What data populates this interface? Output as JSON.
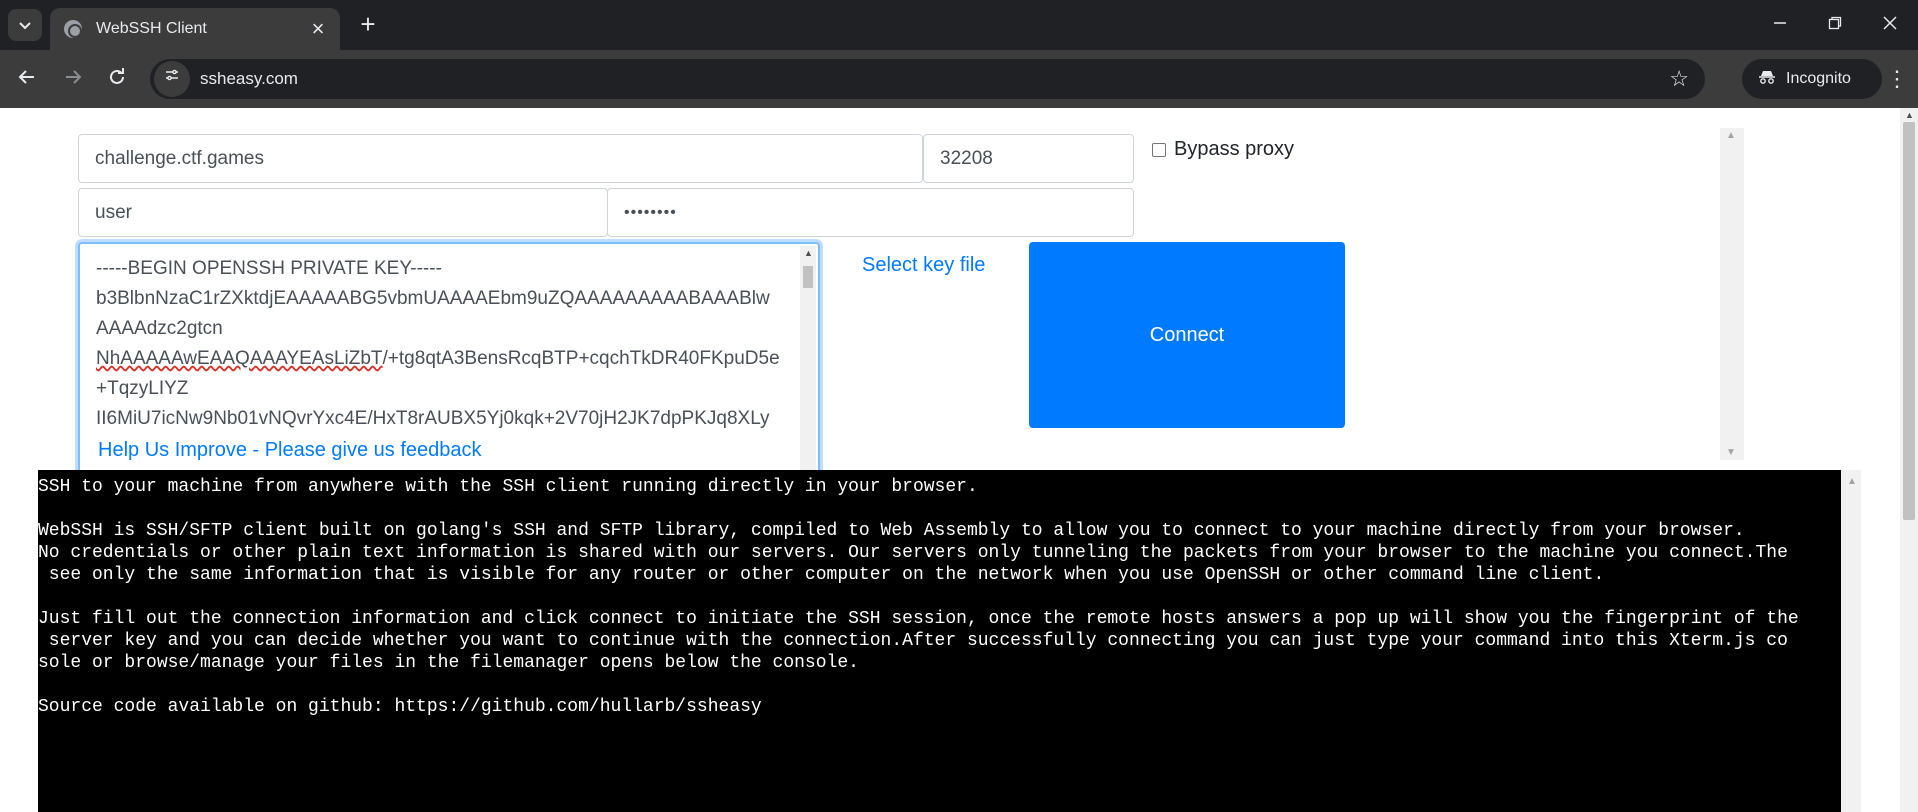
{
  "browser": {
    "tab_title": "WebSSH Client",
    "url": "ssheasy.com",
    "incognito_label": "Incognito",
    "icons": [
      "tab-search-icon",
      "favicon-icon",
      "close-icon",
      "new-tab-icon",
      "minimize-icon",
      "restore-icon",
      "window-close-icon",
      "back-icon",
      "forward-icon",
      "reload-icon",
      "site-info-icon",
      "bookmark-star-icon",
      "incognito-icon",
      "menu-icon"
    ]
  },
  "form": {
    "host": "challenge.ctf.games",
    "port": "32208",
    "username": "user",
    "password": "••••••••",
    "bypass_proxy_label": "Bypass proxy",
    "bypass_proxy_checked": false,
    "key_lines": [
      "-----BEGIN OPENSSH PRIVATE KEY-----",
      "b3BlbnNzaC1rZXktdjEAAAAABG5vbmUAAAAEbm9uZQAAAAAAAAABAAABlw",
      "AAAAdzc2gtcn",
      "NhAAAAAwEAAQAAAYEAsLiZbT/+tg8qtA3BensRcqBTP+cqchTkDR40FKpuD5e",
      "+TqzyLIYZ",
      "II6MiU7icNw9Nb01vNQvrYxc4E/HxT8rAUBX5Yj0kqk+2V70jH2JK7dpPKJq8XLy"
    ],
    "select_key_label": "Select key file",
    "connect_label": "Connect",
    "feedback_label": "Help Us Improve - Please give us feedback"
  },
  "terminal": {
    "lines": [
      "SSH to your machine from anywhere with the SSH client running directly in your browser.",
      "",
      "WebSSH is SSH/SFTP client built on golang's SSH and SFTP library, compiled to Web Assembly to allow you to connect to your machine directly from your browser.",
      "No credentials or other plain text information is shared with our servers. Our servers only tunneling the packets from your browser to the machine you connect.The",
      " see only the same information that is visible for any router or other computer on the network when you use OpenSSH or other command line client.",
      "",
      "Just fill out the connection information and click connect to initiate the SSH session, once the remote hosts answers a pop up will show you the fingerprint of the",
      " server key and you can decide whether you want to continue with the connection.After successfully connecting you can just type your command into this Xterm.js co",
      "sole or browse/manage your files in the filemanager opens below the console.",
      "",
      "Source code available on github: https://github.com/hullarb/ssheasy"
    ]
  }
}
